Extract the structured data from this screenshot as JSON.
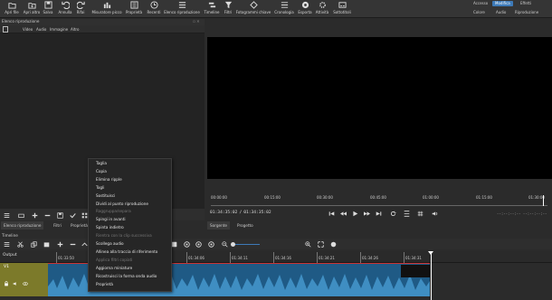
{
  "toolbar": {
    "items": [
      {
        "label": "Apri file",
        "icon": "folder-open-icon"
      },
      {
        "label": "Apri altro",
        "icon": "folder-open-other-icon"
      },
      {
        "label": "Salva",
        "icon": "save-icon"
      },
      {
        "label": "Annulla",
        "icon": "undo-icon"
      },
      {
        "label": "Rifai",
        "icon": "redo-icon"
      },
      {
        "label": "Misuratore picco",
        "icon": "peak-meter-icon"
      },
      {
        "label": "Proprietà",
        "icon": "properties-icon"
      },
      {
        "label": "Recenti",
        "icon": "recent-icon"
      },
      {
        "label": "Elenco riproduzione",
        "icon": "playlist-icon"
      },
      {
        "label": "Timeline",
        "icon": "timeline-icon"
      },
      {
        "label": "Filtri",
        "icon": "filter-icon"
      },
      {
        "label": "Fotogrammi chiave",
        "icon": "keyframes-icon"
      },
      {
        "label": "Cronologia",
        "icon": "history-icon"
      },
      {
        "label": "Esporta",
        "icon": "export-icon"
      },
      {
        "label": "Attività",
        "icon": "jobs-icon"
      },
      {
        "label": "Sottotitoli",
        "icon": "subtitles-icon"
      }
    ],
    "layouts_top": [
      "Accesso",
      "Modifica",
      "Effetti"
    ],
    "layouts_bottom": [
      "Colore",
      "Audio",
      "Riproduzione"
    ],
    "active_layout": "Modifica"
  },
  "playlist": {
    "title": "Elenco riproduzione",
    "tabs": [
      "Video",
      "Audio",
      "Immagine",
      "Altro"
    ]
  },
  "player": {
    "ruler_ticks": [
      "00:00:00",
      "00:15:00",
      "00:30:00",
      "00:45:00",
      "01:00:00",
      "01:15:00",
      "01:30:00"
    ],
    "timecode_current": "01:34:35:02",
    "timecode_total": "01:34:35:02",
    "in_point": "--:--:--:--",
    "out_point": "--:--:--:--",
    "tabs": [
      "Sorgente",
      "Progetto"
    ]
  },
  "bottom_tabs": [
    "Elenco riproduzione",
    "Filtri",
    "Proprietà"
  ],
  "timeline": {
    "label": "Timeline",
    "output_label": "Output",
    "track_name": "V1",
    "ruler_ticks": [
      "01:33:50",
      "01:33:56",
      "01:34:06",
      "01:34:11",
      "01:34:16",
      "01:34:21",
      "01:34:26",
      "01:34:31"
    ]
  },
  "context_menu": {
    "items": [
      {
        "label": "Taglia",
        "disabled": false
      },
      {
        "label": "Copia",
        "disabled": false
      },
      {
        "label": "Elimina ripple",
        "disabled": false
      },
      {
        "label": "Togli",
        "disabled": false
      },
      {
        "label": "Sostituisci",
        "disabled": false
      },
      {
        "label": "Dividi al punto riproduzione",
        "disabled": false
      },
      {
        "label": "Raggruppa/separa",
        "disabled": true
      },
      {
        "label": "Spingi in avanti",
        "disabled": false
      },
      {
        "label": "Spinta indietro",
        "disabled": false
      },
      {
        "label": "Rientra con la clip successiva",
        "disabled": true
      },
      {
        "label": "Scollega audio",
        "disabled": false
      },
      {
        "label": "Allinea alla traccia di riferimento",
        "disabled": false
      },
      {
        "label": "Applica filtri copiati",
        "disabled": true
      },
      {
        "label": "Aggiorna miniature",
        "disabled": false
      },
      {
        "label": "Ricostruisci la forma onda audio",
        "disabled": false
      },
      {
        "label": "Proprietà",
        "disabled": false
      }
    ]
  },
  "colors": {
    "accent": "#3d7ab8",
    "clip": "#1f5a85",
    "track_head": "#7c7a2a",
    "background": "#2b2b2b"
  }
}
